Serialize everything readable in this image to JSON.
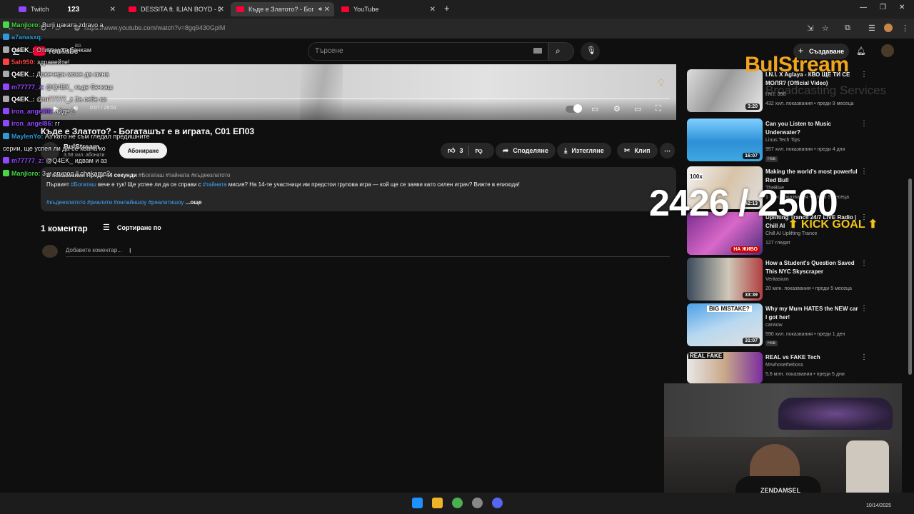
{
  "browser": {
    "tabs": [
      {
        "label": "Twitch",
        "count": "123"
      },
      {
        "label": "DESSITA ft. ILIAN BOYD - DOB!"
      },
      {
        "label": "Къде е Златото? - Богаташ"
      },
      {
        "label": "YouTube"
      }
    ],
    "url": "https://www.youtube.com/watch?v=8gq9430GplM"
  },
  "masthead": {
    "logo": "YouTube",
    "region": "BG",
    "search_placeholder": "Търсене",
    "create_label": "Създаване"
  },
  "player": {
    "time": "0:07 / 29:51",
    "progress": 0.004
  },
  "video": {
    "title": "Къде е Златото? - Богаташът е в играта, С01 ЕП03",
    "channel": "BulStream",
    "subscribers": "3,58 хил. абонати",
    "subscribe_label": "Абониране",
    "likes": "3",
    "share_label": "Споделяне",
    "download_label": "Изтегляне",
    "clip_label": "Клип"
  },
  "description": {
    "meta": "В показвания  Преди 44 секунди",
    "meta_tags": "#Богаташ #тайната #къдеезлатото",
    "line_prefix": "Първият",
    "line_link1": "#Богаташ",
    "line_mid": "вече е тук! Ще успее ли да се справи с",
    "line_link2": "#тайната",
    "line_suffix": "мисия? На 14-те участници им предстои групова игра — кой ще се заяви като силен играч? Вижте в епизода!",
    "tags": "#къдеезлатото #риалити #онлайншоу #реалитишоу",
    "more": "...още"
  },
  "comments": {
    "count": "1 коментар",
    "sort_label": "Сортиране по",
    "placeholder": "Добавете коментар..."
  },
  "recommendations": [
    {
      "title": "I.N.I. X Aglaya - КВО ЩЕ ТИ СЕ МОЛЯ? (Official Video)",
      "channel": "I.N.I. 056",
      "meta": "432 хил. показвания • преди 9 месеца",
      "duration": "3:20",
      "badge": ""
    },
    {
      "title": "Can you Listen to Music Underwater?",
      "channel": "Linus Tech Tips",
      "meta": "957 хил. показвания • преди 4 дни",
      "duration": "16:07",
      "badge": "Нов"
    },
    {
      "title": "Making the world's most powerful Red Bull",
      "channel": "TheBlue",
      "meta": "1 млн. показвания • преди 5 месеца",
      "duration": "42:13",
      "badge": ""
    },
    {
      "title": "Uplifting Trance 24/7 LIVE Radio | Chill AI",
      "channel": "Chill AI Uplifting Trance",
      "meta": "127 гледат",
      "duration": "",
      "live": "НА ЖИВО",
      "badge": ""
    },
    {
      "title": "How a Student's Question Saved This NYC Skyscraper",
      "channel": "Veritasium",
      "meta": "20 млн. показвания • преди 5 месеца",
      "duration": "33:39",
      "badge": ""
    },
    {
      "title": "Why my Mum HATES the NEW car I got her!",
      "channel": "carwow",
      "meta": "590 хил. показвания • преди 1 ден",
      "duration": "31:07",
      "badge": "Нов",
      "thumb_text": "BIG MISTAKE?"
    },
    {
      "title": "REAL vs FAKE Tech",
      "channel": "Mrwhosetheboss",
      "meta": "5,6 млн. показвания • преди 5 дни",
      "duration": "",
      "badge": "",
      "thumb_text": "REAL   FAKE"
    }
  ],
  "overlay": {
    "logo": "BulStream",
    "subtitle": "Broadcasting Services",
    "goal_value": "2426 / 2500",
    "goal_label": "KICK GOAL",
    "shirt_text": "ZENDAMSEL"
  },
  "chat": [
    {
      "user": "Manjioro:",
      "msg": "Burji цаката zdravo а",
      "color": "#46d846"
    },
    {
      "user": "a7anasxq:",
      "msg": "",
      "color": "#2e9bd6"
    },
    {
      "user": "Q4EK_:",
      "msg": "Отивам да бачкам",
      "color": "#ffffff"
    },
    {
      "user": "5ah950:",
      "msg": "здравейте!",
      "color": "#ff4040"
    },
    {
      "user": "Q4EK_:",
      "msg": "Довечера може да мина",
      "color": "#ffffff"
    },
    {
      "user": "m77777_z:",
      "msg": "@Q4EK_ къде бачкаш",
      "color": "#9146ff"
    },
    {
      "user": "Q4EK_:",
      "msg": "@m77777_z За себе си",
      "color": "#ffffff"
    },
    {
      "user": "iron_angel86:",
      "msg": "айде 5",
      "color": "#9146ff"
    },
    {
      "user": "iron_angel86:",
      "msg": "гг",
      "color": "#9146ff"
    },
    {
      "user": "MaylenYo:",
      "msg": "Аз като не съм гледал предишните",
      "color": "#2e9bd6"
    },
    {
      "user": "",
      "msg": "серии, ще успея ли да се хвана ко",
      "color": "#ffffff"
    },
    {
      "user": "m77777_z:",
      "msg": "@Q4EK_ идвам и аз",
      "color": "#9146ff"
    },
    {
      "user": "Manjioro:",
      "msg": "3-и епизод ll chakame?",
      "color": "#46d846"
    }
  ],
  "taskbar": {
    "date": "10/14/2025"
  },
  "colors": {
    "accent": "#ff0033",
    "link": "#3ea6ff",
    "background": "#0f0f0f",
    "goal": "#f0c419"
  }
}
